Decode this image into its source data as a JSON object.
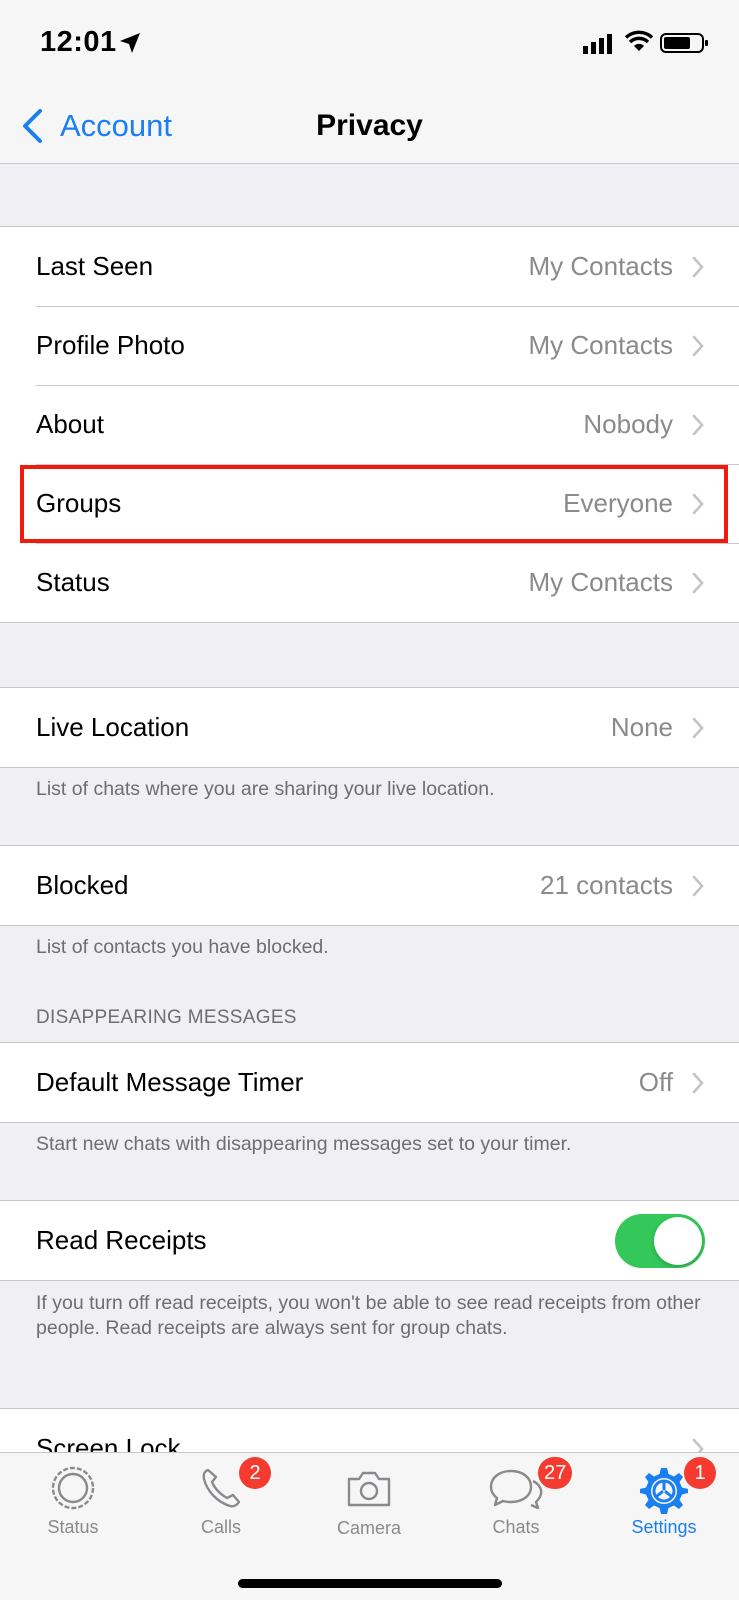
{
  "status_bar": {
    "time": "12:01"
  },
  "nav": {
    "back_label": "Account",
    "title": "Privacy"
  },
  "section1": [
    {
      "label": "Last Seen",
      "value": "My Contacts"
    },
    {
      "label": "Profile Photo",
      "value": "My Contacts"
    },
    {
      "label": "About",
      "value": "Nobody"
    },
    {
      "label": "Groups",
      "value": "Everyone"
    },
    {
      "label": "Status",
      "value": "My Contacts"
    }
  ],
  "live_location": {
    "label": "Live Location",
    "value": "None",
    "footnote": "List of chats where you are sharing your live location."
  },
  "blocked": {
    "label": "Blocked",
    "value": "21 contacts",
    "footnote": "List of contacts you have blocked."
  },
  "disappearing": {
    "header": "DISAPPEARING MESSAGES",
    "label": "Default Message Timer",
    "value": "Off",
    "footnote": "Start new chats with disappearing messages set to your timer."
  },
  "read_receipts": {
    "label": "Read Receipts",
    "enabled": true,
    "footnote": "If you turn off read receipts, you won't be able to see read receipts from other people. Read receipts are always sent for group chats."
  },
  "screen_lock": {
    "label": "Screen Lock"
  },
  "tabs": [
    {
      "label": "Status",
      "icon": "status-icon",
      "badge": ""
    },
    {
      "label": "Calls",
      "icon": "phone-icon",
      "badge": "2"
    },
    {
      "label": "Camera",
      "icon": "camera-icon",
      "badge": ""
    },
    {
      "label": "Chats",
      "icon": "chat-bubbles-icon",
      "badge": "27"
    },
    {
      "label": "Settings",
      "icon": "gear-icon",
      "badge": "1",
      "active": true
    }
  ],
  "colors": {
    "accent": "#1a7ff0",
    "toggle_on": "#34c759",
    "badge": "#f53b30",
    "highlight": "#ee1c0e"
  }
}
